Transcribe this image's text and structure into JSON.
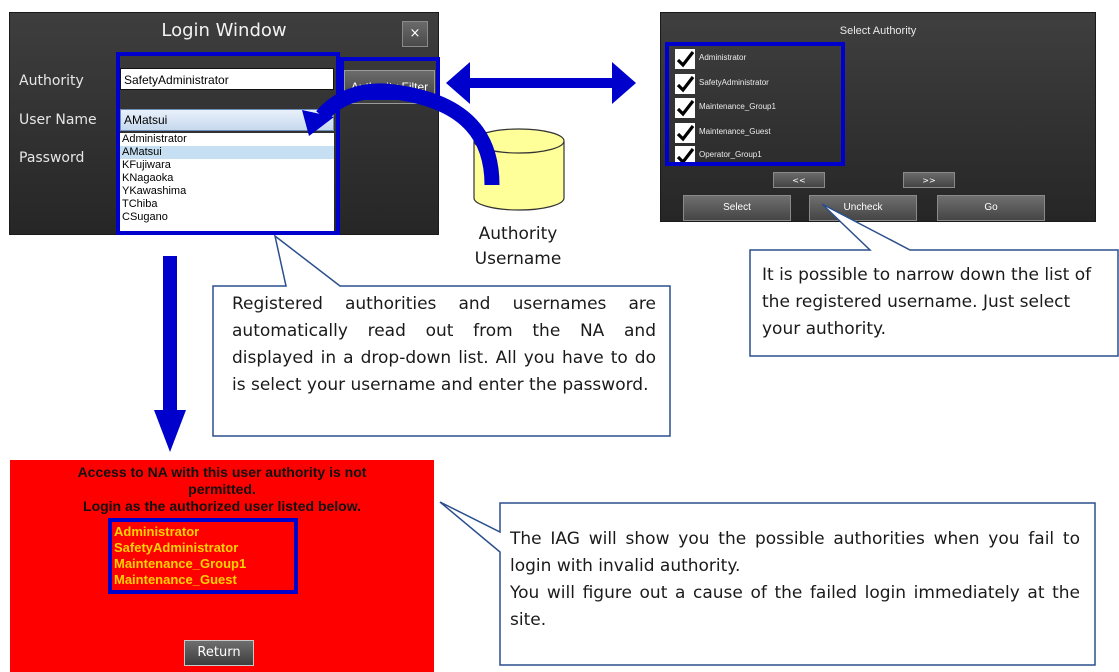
{
  "login_window": {
    "title": "Login Window",
    "close_label": "×",
    "authority_label": "Authority",
    "authority_value": "SafetyAdministrator",
    "authority_filter_label": "Authority Filter",
    "username_label": "User Name",
    "username_value": "AMatsui",
    "password_label": "Password",
    "users": [
      "Administrator",
      "AMatsui",
      "KFujiwara",
      "KNagaoka",
      "YKawashima",
      "TChiba",
      "CSugano"
    ],
    "selected_user": "AMatsui"
  },
  "database": {
    "label_line1": "Authority",
    "label_line2": "Username"
  },
  "select_authority": {
    "title": "Select Authority",
    "authorities": [
      "Administrator",
      "SafetyAdministrator",
      "Maintenance_Group1",
      "Maintenance_Guest",
      "Operator_Group1"
    ],
    "prev_label": "<<",
    "next_label": ">>",
    "select_label": "Select",
    "uncheck_label": "Uncheck",
    "go_label": "Go"
  },
  "callouts": {
    "dropdown": "Registered authorities and usernames are automatically read out from the NA and displayed in a drop-down list. All you have to do is select your username and enter the password.",
    "filter": "It is possible to narrow down the list of the registered username. Just select your authority.",
    "error_lines": [
      "The IAG will show you the possible authorities when you fail to login with invalid authority.",
      "You will figure out a cause of the failed login immediately at the site."
    ]
  },
  "error_panel": {
    "line1": "Access to NA with this user authority is not",
    "line2": "permitted.",
    "line3": "Login as the authorized user listed below.",
    "authorities": [
      "Administrator",
      "SafetyAdministrator",
      "Maintenance_Group1",
      "Maintenance_Guest"
    ],
    "return_label": "Return"
  },
  "colors": {
    "highlight": "#0000cc",
    "error_bg": "#ff0000",
    "error_text": "#ffd200",
    "database": "#ffff99"
  }
}
